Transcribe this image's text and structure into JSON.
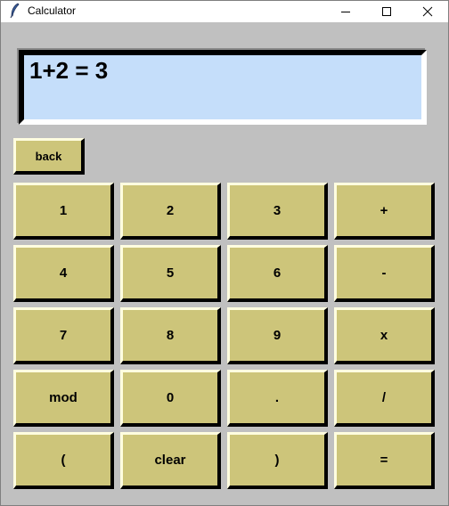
{
  "window": {
    "title": "Calculator",
    "app_icon": "feather-icon"
  },
  "controls": {
    "minimize_icon": "minimize-icon",
    "maximize_icon": "maximize-icon",
    "close_icon": "close-icon"
  },
  "display": {
    "text": "1+2 = 3",
    "background": "#c5defa"
  },
  "back_button": {
    "label": "back"
  },
  "keypad": [
    [
      "1",
      "2",
      "3",
      "+"
    ],
    [
      "4",
      "5",
      "6",
      "-"
    ],
    [
      "7",
      "8",
      "9",
      "x"
    ],
    [
      "mod",
      "0",
      ".",
      "/"
    ],
    [
      "(",
      "clear",
      ")",
      "="
    ]
  ],
  "colors": {
    "button_face": "#cdc57a",
    "window_background": "#c0c0c0"
  }
}
